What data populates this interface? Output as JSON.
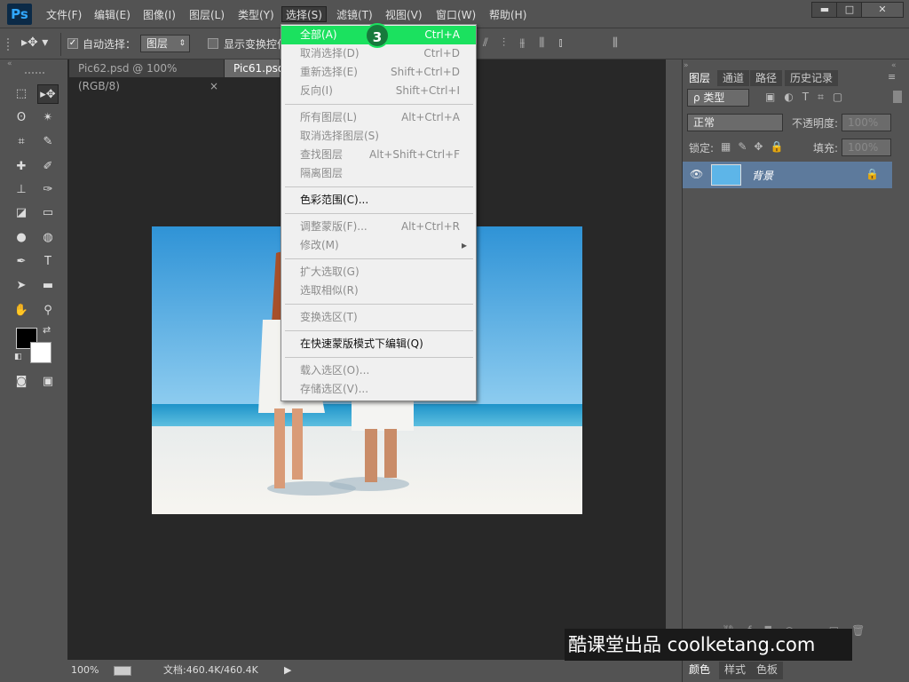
{
  "app": {
    "logo": "Ps"
  },
  "menubar": {
    "items": [
      "文件(F)",
      "编辑(E)",
      "图像(I)",
      "图层(L)",
      "类型(Y)",
      "选择(S)",
      "滤镜(T)",
      "视图(V)",
      "窗口(W)",
      "帮助(H)"
    ],
    "active_index": 5
  },
  "window_controls": {
    "minimize": "▬",
    "maximize": "□",
    "close": "✕"
  },
  "options_bar": {
    "auto_select_label": "自动选择：",
    "auto_select_checked": true,
    "auto_select_value": "图层",
    "show_transform_label": "显示变换控件"
  },
  "tabs": [
    {
      "label": "Pic62.psd @ 100%(RGB/8)",
      "close": "×",
      "active": false
    },
    {
      "label": "Pic61.psd",
      "active": true
    }
  ],
  "status": {
    "zoom": "100%",
    "doc_info": "文档:460.4K/460.4K",
    "arrow": "▶"
  },
  "select_menu": {
    "items": [
      {
        "label": "全部(A)",
        "shortcut": "Ctrl+A",
        "enabled": true,
        "highlighted": true
      },
      {
        "label": "取消选择(D)",
        "shortcut": "Ctrl+D",
        "enabled": false
      },
      {
        "label": "重新选择(E)",
        "shortcut": "Shift+Ctrl+D",
        "enabled": false
      },
      {
        "label": "反向(I)",
        "shortcut": "Shift+Ctrl+I",
        "enabled": false
      },
      {
        "label": "所有图层(L)",
        "shortcut": "Alt+Ctrl+A",
        "enabled": false
      },
      {
        "label": "取消选择图层(S)",
        "shortcut": "",
        "enabled": false
      },
      {
        "label": "查找图层",
        "shortcut": "Alt+Shift+Ctrl+F",
        "enabled": false
      },
      {
        "label": "隔离图层",
        "shortcut": "",
        "enabled": false
      },
      {
        "label": "色彩范围(C)...",
        "shortcut": "",
        "enabled": true
      },
      {
        "label": "调整蒙版(F)...",
        "shortcut": "Alt+Ctrl+R",
        "enabled": false
      },
      {
        "label": "修改(M)",
        "shortcut": "▸",
        "enabled": false
      },
      {
        "label": "扩大选取(G)",
        "shortcut": "",
        "enabled": false
      },
      {
        "label": "选取相似(R)",
        "shortcut": "",
        "enabled": false
      },
      {
        "label": "变换选区(T)",
        "shortcut": "",
        "enabled": false
      },
      {
        "label": "在快速蒙版模式下编辑(Q)",
        "shortcut": "",
        "enabled": true
      },
      {
        "label": "载入选区(O)...",
        "shortcut": "",
        "enabled": false
      },
      {
        "label": "存储选区(V)...",
        "shortcut": "",
        "enabled": false
      }
    ],
    "step_badge": "3"
  },
  "panels": {
    "tabs": [
      "图层",
      "通道",
      "路径",
      "历史记录"
    ],
    "kind_label": "ρ 类型",
    "blend_mode": "正常",
    "opacity_label": "不透明度:",
    "opacity_value": "100%",
    "lock_label": "锁定:",
    "fill_label": "填充:",
    "fill_value": "100%",
    "layer_name": "背景",
    "bottom_tabs": [
      "颜色",
      "样式",
      "色板"
    ]
  },
  "watermark": "酷课堂出品 coolketang.com",
  "colors": {
    "menu_highlight": "#1be15f",
    "badge": "#177a3c"
  }
}
